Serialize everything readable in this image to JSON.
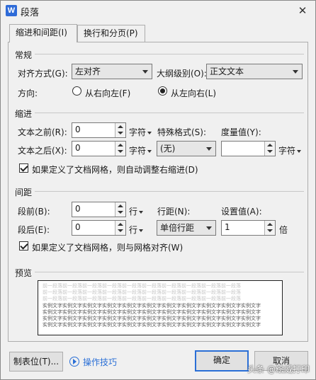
{
  "window": {
    "title": "段落",
    "app_icon_letter": "W",
    "close_glyph": "✕"
  },
  "tabs": [
    {
      "label": "缩进和间距(I)",
      "active": true
    },
    {
      "label": "换行和分页(P)",
      "active": false
    }
  ],
  "general": {
    "title": "常规",
    "alignment_label": "对齐方式(G):",
    "alignment_value": "左对齐",
    "outline_label": "大纲级别(O):",
    "outline_value": "正文文本",
    "direction_label": "方向:",
    "direction_rtl": "从右向左(F)",
    "direction_ltr": "从左向右(L)",
    "direction_selected": "ltr"
  },
  "indent": {
    "title": "缩进",
    "before_label": "文本之前(R):",
    "before_value": "0",
    "before_unit": "字符",
    "after_label": "文本之后(X):",
    "after_value": "0",
    "after_unit": "字符",
    "special_label": "特殊格式(S):",
    "special_value": "(无)",
    "measure_label": "度量值(Y):",
    "measure_value": "",
    "measure_unit": "字符",
    "auto_adjust_label": "如果定义了文档网格，则自动调整右缩进(D)",
    "auto_adjust_checked": true
  },
  "spacing": {
    "title": "间距",
    "before_label": "段前(B):",
    "before_value": "0",
    "before_unit": "行",
    "after_label": "段后(E):",
    "after_value": "0",
    "after_unit": "行",
    "line_label": "行距(N):",
    "line_value": "单倍行距",
    "setting_label": "设置值(A):",
    "setting_value": "1",
    "setting_unit": "倍",
    "snap_grid_label": "如果定义了文档网格，则与网格对齐(W)",
    "snap_grid_checked": true
  },
  "preview": {
    "title": "预览",
    "prev_text": "前一段落前一段落前一段落前一段落前一段落前一段落前一段落前一段落前一段落前一段落",
    "sample_text": "实例文字实例文字实例文字实例文字实例文字实例文字实例文字实例文字实例文字实例文字实例文字"
  },
  "buttons": {
    "tabs_label": "制表位(T)...",
    "tips_label": "操作技巧",
    "ok_label": "确定",
    "cancel_label": "取消"
  },
  "watermark": "头条 @绘威打印"
}
